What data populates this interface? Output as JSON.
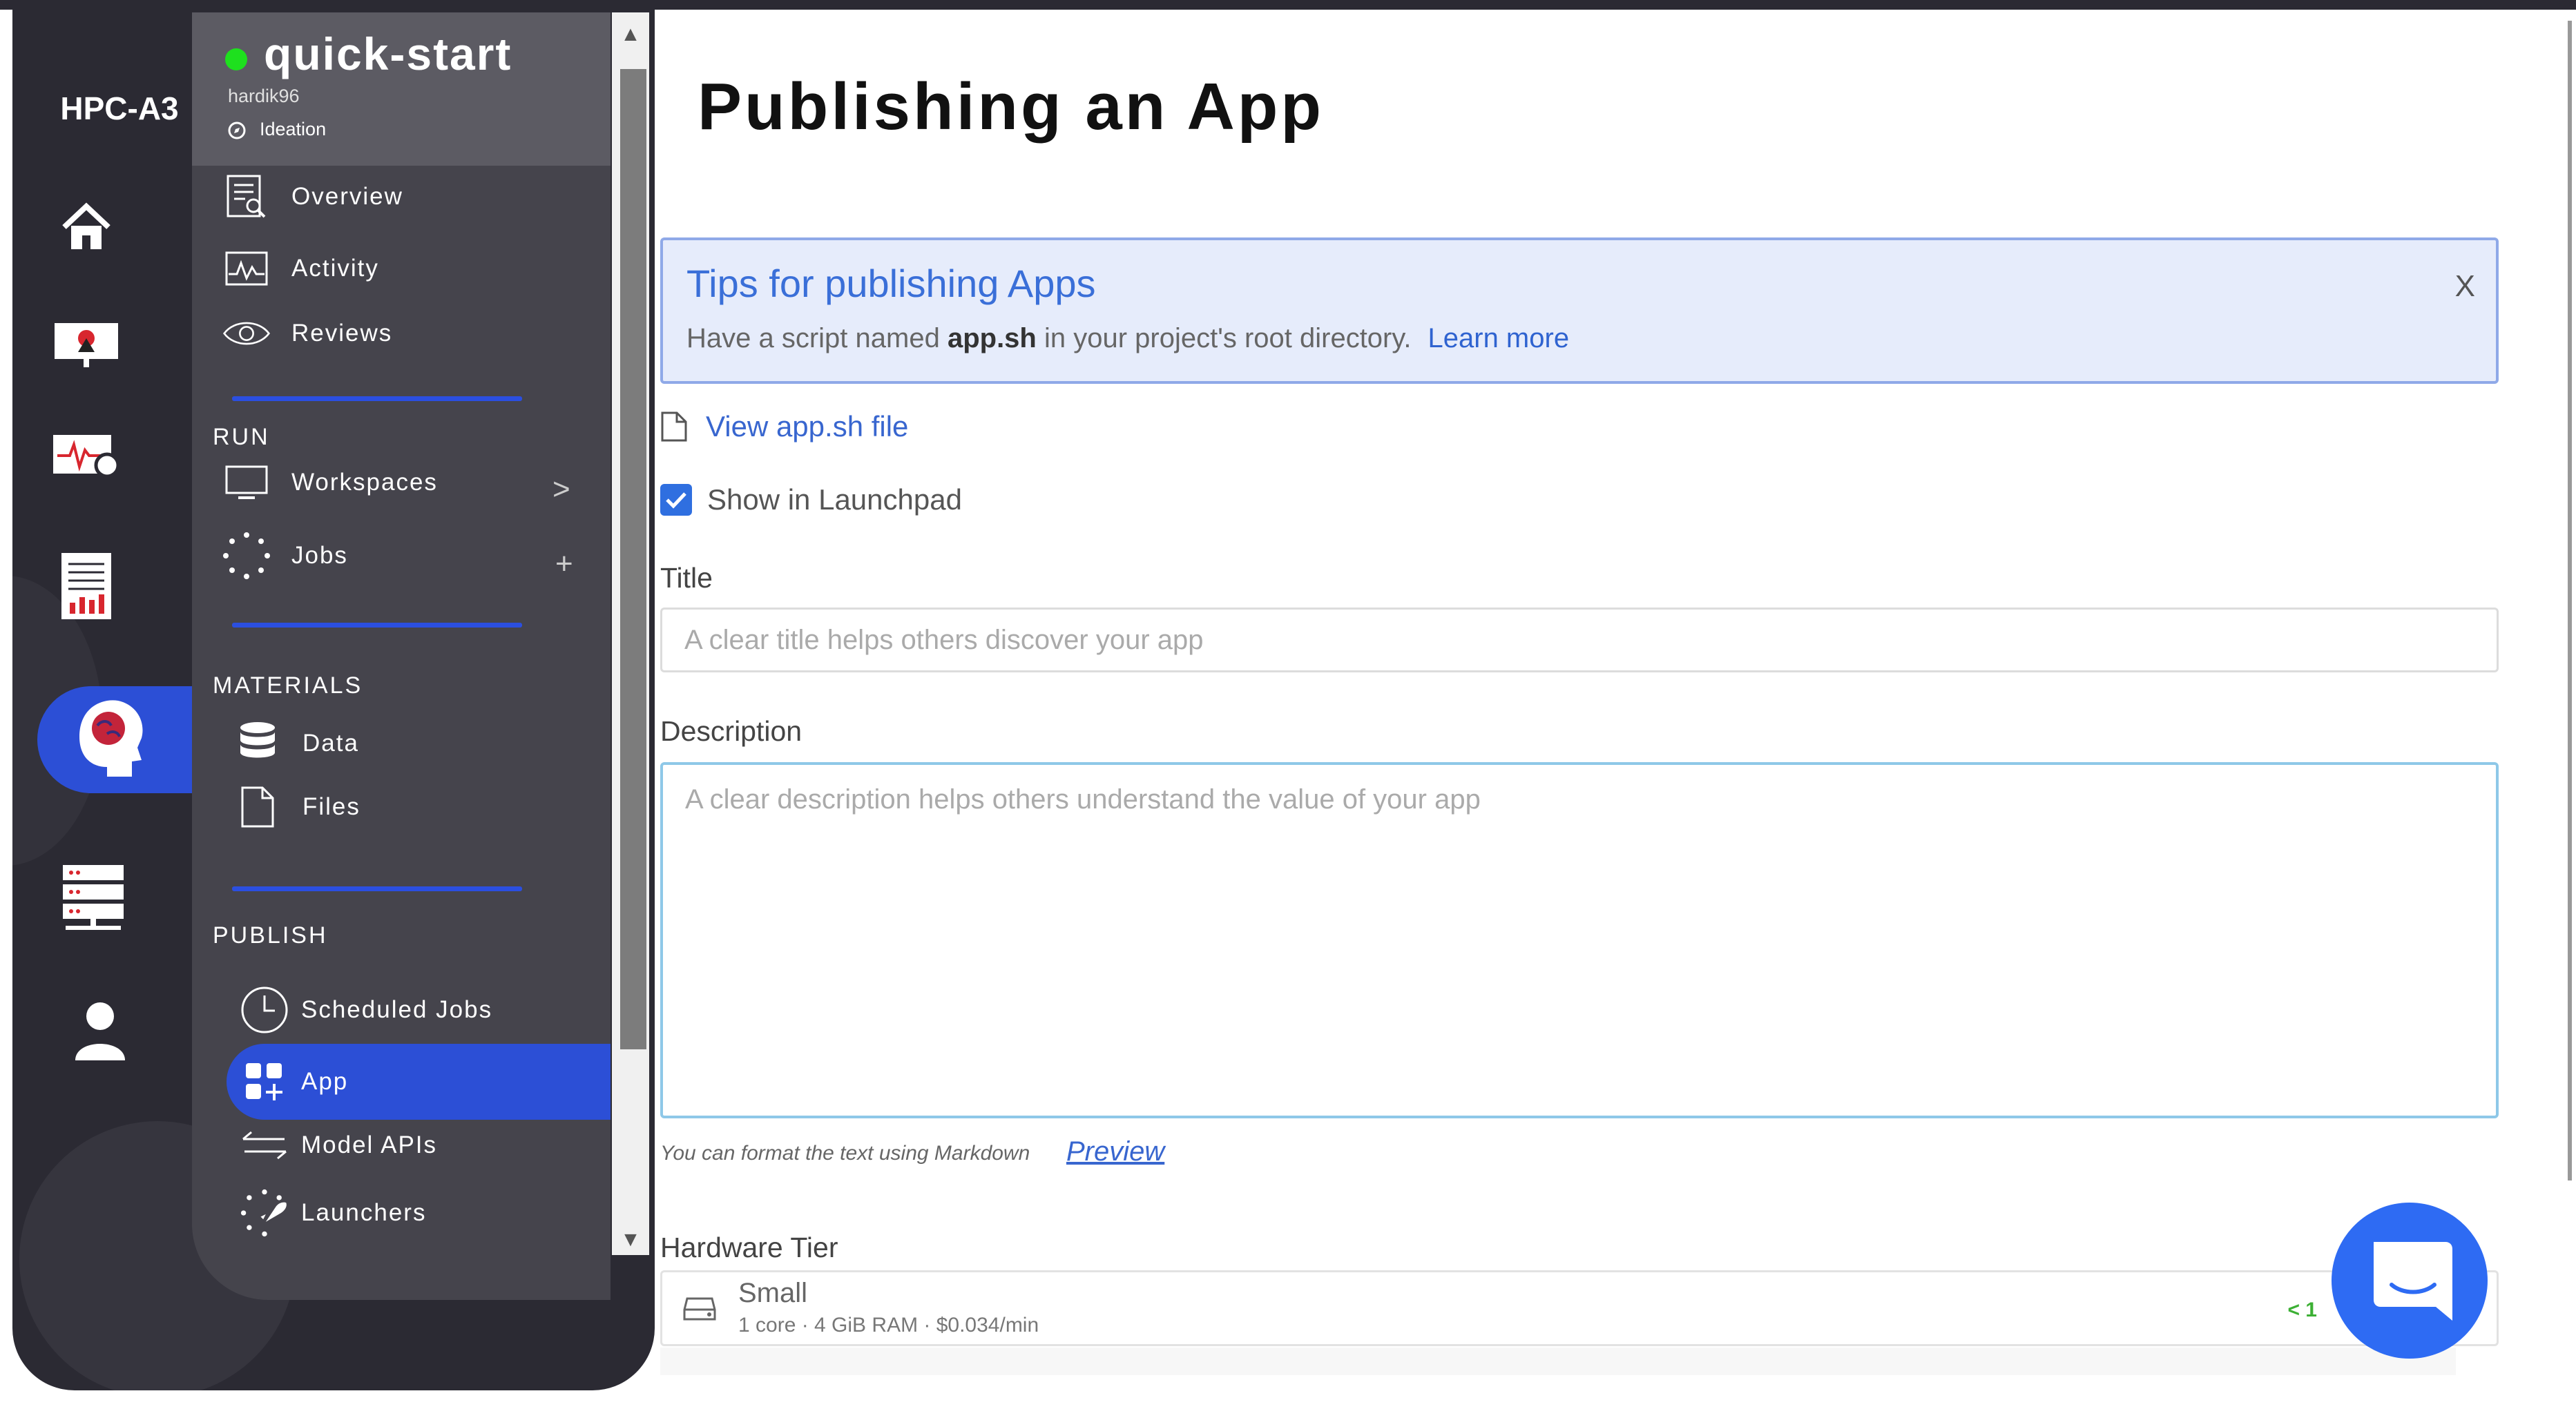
{
  "org": {
    "name": "HPC-A3"
  },
  "project": {
    "name": "quick-start",
    "owner": "hardik96",
    "stage": "Ideation",
    "status_color": "#1ee01e"
  },
  "rail": {
    "icons": [
      "home-icon",
      "presentation-icon",
      "monitor-pulse-icon",
      "report-icon",
      "brain-head-icon",
      "server-icon",
      "user-icon"
    ],
    "active": "brain-head-icon",
    "accent": "#2c4fd6"
  },
  "nav": {
    "overview": "Overview",
    "activity": "Activity",
    "reviews": "Reviews",
    "run_label": "RUN",
    "workspaces": "Workspaces",
    "workspaces_suffix": ">",
    "jobs": "Jobs",
    "jobs_suffix": "+",
    "materials_label": "MATERIALS",
    "data": "Data",
    "files": "Files",
    "publish_label": "PUBLISH",
    "scheduled_jobs": "Scheduled Jobs",
    "app": "App",
    "model_apis": "Model APIs",
    "launchers": "Launchers",
    "active": "App"
  },
  "scrollbar": {
    "up": "▲",
    "down": "▼"
  },
  "main": {
    "title": "Publishing an App",
    "tips": {
      "title": "Tips for publishing Apps",
      "text_before": "Have a script named ",
      "text_bold": "app.sh",
      "text_after": " in your project's root directory.",
      "link": "Learn more",
      "close": "X"
    },
    "view_file_link": "View app.sh file",
    "show_launchpad": {
      "label": "Show in Launchpad",
      "checked": true
    },
    "title_field": {
      "label": "Title",
      "placeholder": "A clear title helps others discover your app"
    },
    "description_field": {
      "label": "Description",
      "placeholder": "A clear description helps others understand the value of your app"
    },
    "markdown_hint": "You can format the text using Markdown",
    "preview_link": "Preview",
    "hardware": {
      "label": "Hardware Tier",
      "selected_name": "Small",
      "selected_spec": "1 core · 4 GiB RAM · $0.034/min",
      "badge": "< 1"
    }
  }
}
